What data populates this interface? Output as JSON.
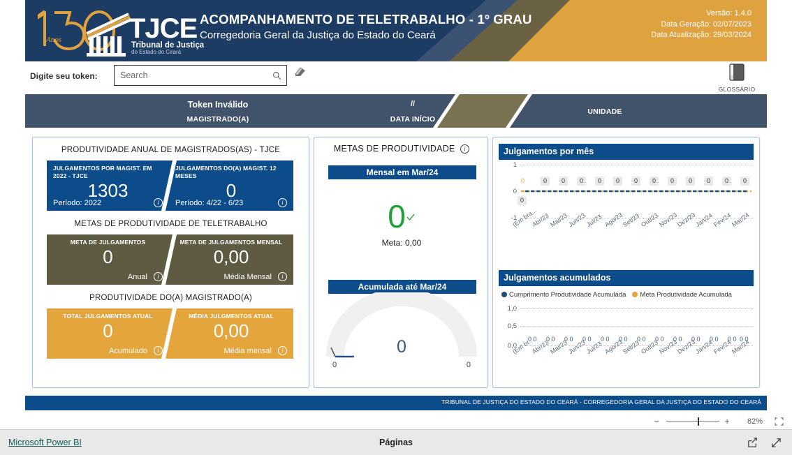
{
  "header": {
    "title": "ACOMPANHAMENTO DE TELETRABALHO - 1º GRAU",
    "subtitle": "Corregedoria Geral da Justiça do Estado do Ceará",
    "logo_years": "150",
    "logo_anos": "Anos",
    "logo_acronym": "TJCE",
    "logo_line1": "Tribunal de Justiça",
    "logo_line2": "do Estado do Ceará",
    "version": "Versão: 1.4.0",
    "generation_date": "Data Geração: 02/07/2023",
    "update_date": "Data Atualização: 29/03/2024",
    "colors": {
      "navy": "#1c3c64",
      "slate": "#3b5273",
      "olive": "#6b6244",
      "amber": "#e0a23e"
    }
  },
  "token_bar": {
    "label": "Digite seu token:",
    "search_placeholder": "Search",
    "search_value": "",
    "search_icon": "search-icon",
    "eraser_icon": "eraser-icon",
    "glossary_label": "GLOSSÁRIO",
    "glossary_icon": "book-icon"
  },
  "slicers": [
    {
      "top": "Token Inválido",
      "bottom": "MAGISTRADO(A)",
      "state": "inactive"
    },
    {
      "top": "//",
      "bottom": "DATA INÍCIO",
      "state": "active"
    },
    {
      "top": "",
      "bottom": "UNIDADE",
      "state": "inactive"
    }
  ],
  "left_panel": {
    "section1_title": "PRODUTIVIDADE ANUAL DE MAGISTRADOS(AS) - TJCE",
    "section2_title": "METAS DE PRODUTIVIDADE DE TELETRABALHO",
    "section3_title": "PRODUTIVIDADE DO(A) MAGISTRADO(A)",
    "tiles": [
      {
        "caption": "JULGAMENTOS POR MAGIST. EM 2022 - TJCE",
        "value": "1303",
        "footer": "Período: 2022",
        "color": "#0d4c8b",
        "info_icon": "info-icon"
      },
      {
        "caption": "JULGAMENTOS DO(A) MAGIST. 12 MESES",
        "value": "0",
        "footer": "Período: 4/22 - 6/23",
        "color": "#0d4c8b",
        "info_icon": "info-icon"
      },
      {
        "caption": "META DE JULGAMENTOS",
        "value": "0",
        "footer": "Anual",
        "color": "#5f5b42",
        "info_icon": "info-icon"
      },
      {
        "caption": "META DE JULGAMENTOS MENSAL",
        "value": "0,00",
        "footer": "Média Mensal",
        "color": "#5f5b42",
        "info_icon": "info-icon"
      },
      {
        "caption": "TOTAL JULGAMENTOS ATUAL",
        "value": "0",
        "footer": "Acumulado",
        "color": "#e3a53c",
        "info_icon": "info-icon"
      },
      {
        "caption": "MÉDIA JULGMENTOS ATUAL",
        "value": "0,00",
        "footer": "Média mensal",
        "color": "#e3a53c",
        "info_icon": "info-icon"
      }
    ]
  },
  "mid_panel": {
    "title": "METAS DE PRODUTIVIDADE",
    "info_icon": "info-icon",
    "monthly": {
      "header": "Mensal em Mar/24",
      "value": "0",
      "value_color": "#22a03b",
      "check_icon": "check-icon",
      "meta_label": "Meta: 0,00"
    },
    "accumulated": {
      "header": "Acumulada até Mar/24",
      "value": "0",
      "min": "0",
      "max": "0"
    }
  },
  "right_panel": {
    "chart1_title": "Julgamentos por mês",
    "chart2_title": "Julgamentos acumulados",
    "legend": [
      {
        "label": "Cumprimento Produtividade Acumulada",
        "color": "#1f4e79"
      },
      {
        "label": "Meta Produtividade Acumulada",
        "color": "#e3a53c"
      }
    ]
  },
  "chart_data": [
    {
      "type": "line",
      "title": "Julgamentos por mês",
      "categories": [
        "(Em bra...",
        "Abr/23",
        "Mai/23",
        "Jun/23",
        "Jul/23",
        "Ago/23",
        "Set/23",
        "Out/23",
        "Nov/23",
        "Dez/23",
        "Jan/24",
        "Fev/24",
        "Mar/24"
      ],
      "series": [
        {
          "name": "Cumprimento Produtividade",
          "color": "#1f4e79",
          "values": [
            0,
            0,
            0,
            0,
            0,
            0,
            0,
            0,
            0,
            0,
            0,
            0,
            0
          ]
        },
        {
          "name": "Meta Produtividade",
          "color": "#e3a53c",
          "values": [
            0,
            0,
            0,
            0,
            0,
            0,
            0,
            0,
            0,
            0,
            0,
            0,
            0
          ]
        }
      ],
      "yticks": [
        "1",
        "0",
        "-1"
      ],
      "ylim": [
        -1,
        1
      ],
      "grid": true,
      "legend_position": "none",
      "data_labels_above": [
        "0",
        "0",
        "0",
        "0",
        "0",
        "0",
        "0",
        "0",
        "0",
        "0",
        "0",
        "0"
      ],
      "data_label_below": "0",
      "data_label_orange": "0"
    },
    {
      "type": "line",
      "title": "Julgamentos acumulados",
      "categories": [
        "(Em br...",
        "Abr/23",
        "Mai/23",
        "Jun/23",
        "Jul/23",
        "Ago/23",
        "Set/23",
        "Out/23",
        "Nov/23",
        "Dez/23",
        "Jan/24",
        "Fev/24",
        "Mar/24"
      ],
      "series": [
        {
          "name": "Cumprimento Produtividade Acumulada",
          "color": "#1f4e79",
          "values": [
            0,
            0,
            0,
            0,
            0,
            0,
            0,
            0,
            0,
            0,
            0,
            0,
            0
          ]
        },
        {
          "name": "Meta Produtividade Acumulada",
          "color": "#e3a53c",
          "values": [
            0,
            0,
            0,
            0,
            0,
            0,
            0,
            0,
            0,
            0,
            0,
            0,
            0
          ]
        }
      ],
      "yticks": [
        "1,0",
        "0,5",
        "0,0"
      ],
      "ylim": [
        0,
        1
      ],
      "grid": true,
      "legend_position": "top",
      "data_labels": [
        "0 0",
        "0 0",
        "0 0",
        "0 0",
        "0 0",
        "0 0",
        "0 0",
        "0 0",
        "0 0",
        "0 0",
        "0 0",
        "0 0",
        "0 0"
      ]
    }
  ],
  "footer": {
    "text": "TRIBUNAL DE JUSTIÇA DO ESTADO DO CEARÁ - CORREGEDORIA GERAL DA JUSTIÇA DO ESTADO DO CEARÁ"
  },
  "zoom_bar": {
    "minus": "−",
    "plus": "+",
    "percent": "82%",
    "fit_icon": "fit-to-page-icon"
  },
  "bottom_bar": {
    "brand": "Microsoft Power BI",
    "pages": "Páginas",
    "share_icon": "share-icon",
    "fullscreen_icon": "fullscreen-icon"
  }
}
